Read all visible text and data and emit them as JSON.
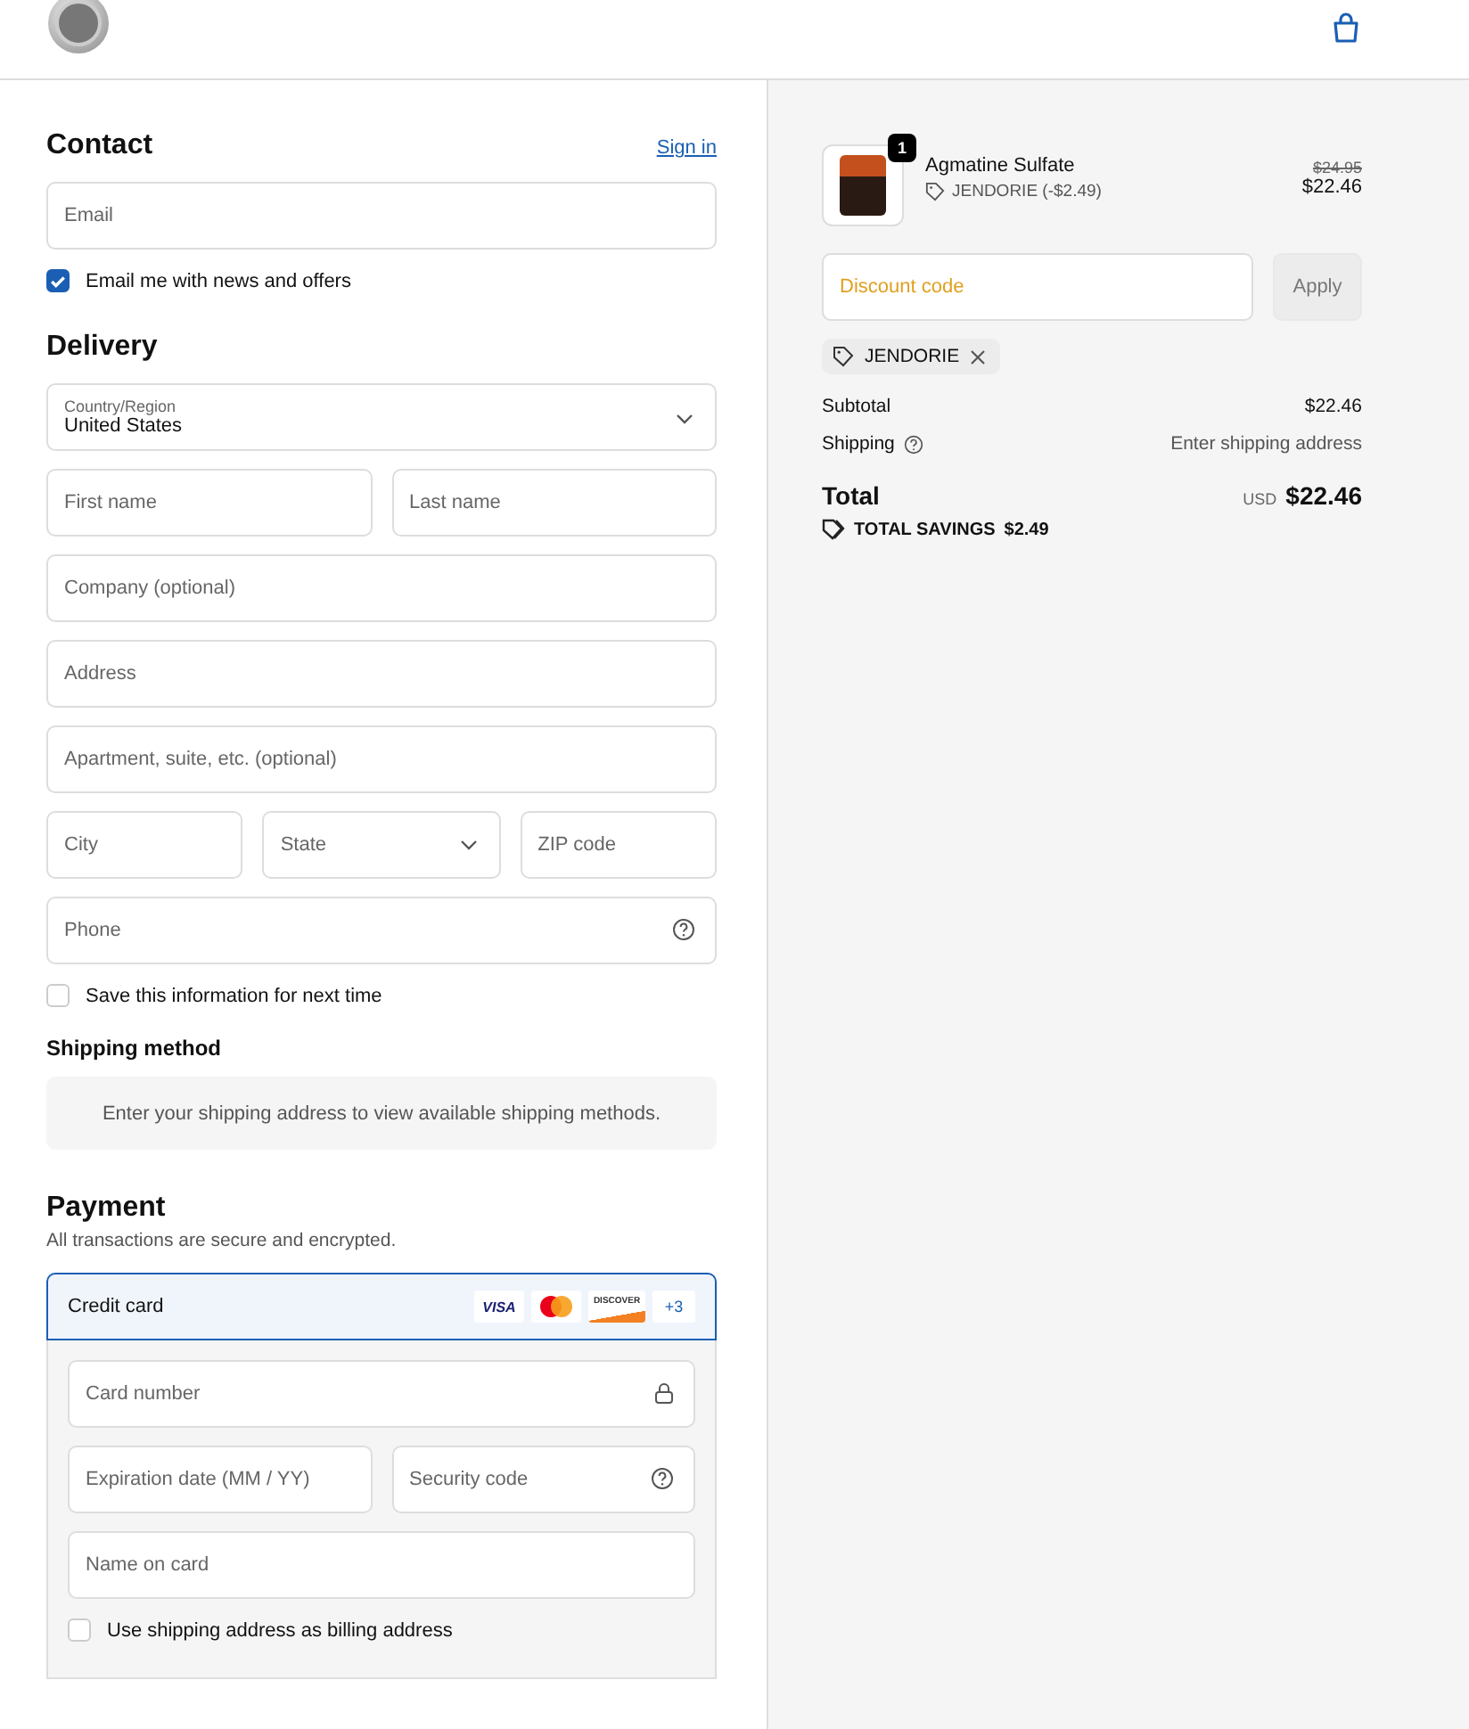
{
  "contact": {
    "heading": "Contact",
    "sign_in": "Sign in",
    "email": {
      "placeholder": "Email"
    },
    "newsletter": {
      "label": "Email me with news and offers",
      "checked": true
    }
  },
  "delivery": {
    "heading": "Delivery",
    "country": {
      "label": "Country/Region",
      "value": "United States"
    },
    "rows": [
      [
        {
          "placeholder": "First name",
          "kind": "text"
        },
        {
          "placeholder": "Last name",
          "kind": "text"
        }
      ],
      [
        {
          "placeholder": "Company (optional)",
          "kind": "text"
        }
      ],
      [
        {
          "placeholder": "Address",
          "kind": "text"
        }
      ],
      [
        {
          "placeholder": "Apartment, suite, etc. (optional)",
          "kind": "text"
        }
      ],
      [
        {
          "placeholder": "City",
          "kind": "text"
        },
        {
          "placeholder": "State",
          "kind": "select"
        },
        {
          "placeholder": "ZIP code",
          "kind": "text"
        }
      ],
      [
        {
          "placeholder": "Phone",
          "kind": "help"
        }
      ]
    ],
    "save_info": {
      "label": "Save this information for next time",
      "checked": false
    }
  },
  "shipping_method": {
    "heading": "Shipping method",
    "message": "Enter your shipping address to view available shipping methods."
  },
  "payment": {
    "heading": "Payment",
    "subtitle": "All transactions are secure and encrypted.",
    "method": {
      "label": "Credit card",
      "selected": true,
      "brands": [
        {
          "kind": "visa",
          "label": "VISA"
        },
        {
          "kind": "mastercard"
        },
        {
          "kind": "discover",
          "label": "DISCOVER"
        },
        {
          "kind": "more",
          "label": "+3"
        }
      ]
    },
    "rows": [
      [
        {
          "placeholder": "Card number",
          "kind": "lock"
        }
      ],
      [
        {
          "placeholder": "Expiration date (MM / YY)",
          "kind": "text"
        },
        {
          "placeholder": "Security code",
          "kind": "help"
        }
      ],
      [
        {
          "placeholder": "Name on card",
          "kind": "text"
        }
      ]
    ],
    "billing": {
      "label": "Use shipping address as billing address",
      "checked": false
    }
  },
  "summary": {
    "item": {
      "name": "Agmatine Sulfate",
      "quantity": "1",
      "discount": "JENDORIE (-$2.49)",
      "original_price": "$24.95",
      "price": "$22.46"
    },
    "discount_field": {
      "placeholder": "Discount code",
      "button": "Apply"
    },
    "applied_code": "JENDORIE",
    "subtotal": {
      "label": "Subtotal",
      "value": "$22.46"
    },
    "shipping": {
      "label": "Shipping",
      "value": "Enter shipping address"
    },
    "total": {
      "label": "Total",
      "currency": "USD",
      "amount": "$22.46"
    },
    "savings": {
      "label": "TOTAL SAVINGS",
      "amount": "$2.49"
    }
  }
}
